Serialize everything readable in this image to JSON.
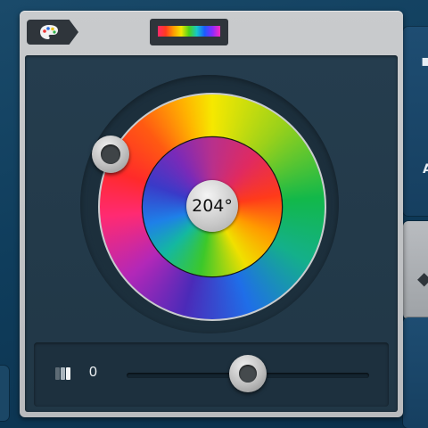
{
  "hue_picker": {
    "hue_degrees": "204°",
    "palette_tab_icon": "palette-icon",
    "spectrum_icon": "spectrum-bar-icon"
  },
  "slider": {
    "icon": "saturation-icon",
    "value": "0",
    "position_fraction": 0.5
  },
  "colors": {
    "window_frame": "#c9cbcd",
    "panel_dark": "#253d4e",
    "knob": "#bfbfbf"
  }
}
